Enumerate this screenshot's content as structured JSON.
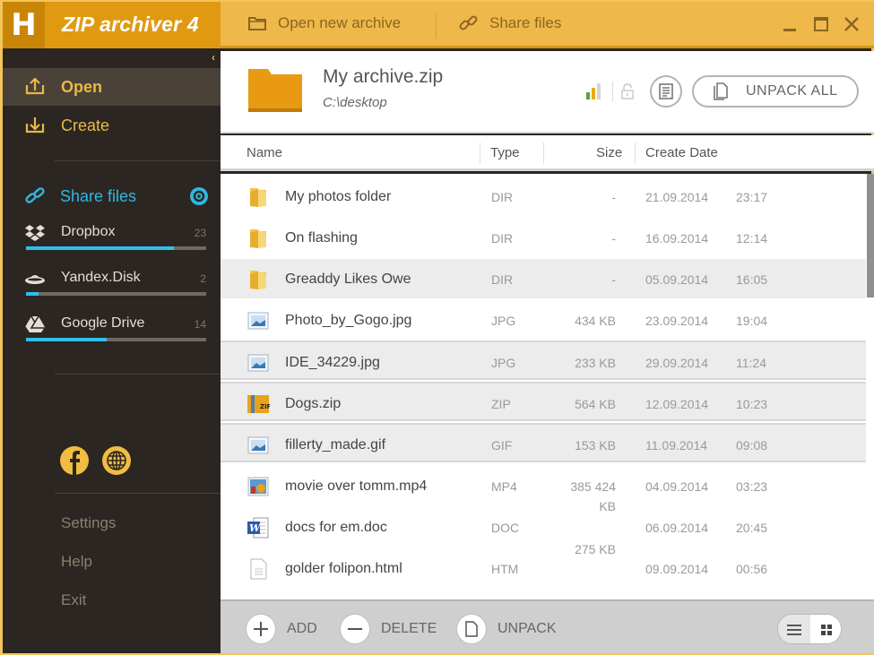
{
  "app": {
    "logo_letter": "H",
    "title": "ZIP archiver 4"
  },
  "colors": {
    "brand_orange": "#e09a12",
    "toolbar_yellow": "#efb84a",
    "sidebar_dark": "#2b2621",
    "accent_gold": "#e9b945",
    "share_blue": "#2fb7e2",
    "progress_blue": "#2ec0ec"
  },
  "toolbar": {
    "open_new_archive": "Open new archive",
    "share_files": "Share files",
    "icons": [
      "folder-icon",
      "link-icon",
      "minimize-icon",
      "maximize-icon",
      "close-icon"
    ]
  },
  "sidebar": {
    "collapse_glyph": "‹",
    "nav": [
      {
        "label": "Open",
        "icon": "open-upload-icon",
        "active": true
      },
      {
        "label": "Create",
        "icon": "create-download-icon",
        "active": false
      }
    ],
    "share": {
      "label": "Share files",
      "icon": "link-icon",
      "settings_icon": "gear-icon"
    },
    "clouds": [
      {
        "name": "Dropbox",
        "count": "23",
        "icon": "dropbox-icon",
        "progress": 0.82
      },
      {
        "name": "Yandex.Disk",
        "count": "2",
        "icon": "yandex-disk-icon",
        "progress": 0.07
      },
      {
        "name": "Google Drive",
        "count": "14",
        "icon": "google-drive-icon",
        "progress": 0.45
      }
    ],
    "social": [
      "facebook-icon",
      "globe-icon"
    ],
    "links": [
      "Settings",
      "Help",
      "Exit"
    ]
  },
  "archive": {
    "name": "My archive.zip",
    "path": "C:\\desktop",
    "unpack_all": "UNPACK ALL",
    "icons": [
      "signal-strength-icon",
      "lock-icon",
      "info-document-icon"
    ]
  },
  "table": {
    "columns": [
      "Name",
      "Type",
      "Size",
      "Create Date"
    ],
    "rows": [
      {
        "name": "My photos folder",
        "type": "DIR",
        "size": "-",
        "date": "21.09.2014",
        "time": "23:17",
        "icon": "folder-icon"
      },
      {
        "name": "On flashing",
        "type": "DIR",
        "size": "-",
        "date": "16.09.2014",
        "time": "12:14",
        "icon": "folder-icon"
      },
      {
        "name": "Greaddy Likes Owe",
        "type": "DIR",
        "size": "-",
        "date": "05.09.2014",
        "time": "16:05",
        "icon": "folder-icon"
      },
      {
        "name": "Photo_by_Gogo.jpg",
        "type": "JPG",
        "size": "434 KB",
        "date": "23.09.2014",
        "time": "19:04",
        "icon": "image-file-icon"
      },
      {
        "name": "IDE_34229.jpg",
        "type": "JPG",
        "size": "233 KB",
        "date": "29.09.2014",
        "time": "11:24",
        "icon": "image-file-icon"
      },
      {
        "name": "Dogs.zip",
        "type": "ZIP",
        "size": "564 KB",
        "date": "12.09.2014",
        "time": "10:23",
        "icon": "zip-file-icon"
      },
      {
        "name": "fillerty_made.gif",
        "type": "GIF",
        "size": "153 KB",
        "date": "11.09.2014",
        "time": "09:08",
        "icon": "image-file-icon"
      },
      {
        "name": "movie over tomm.mp4",
        "type": "MP4",
        "size": "385 424",
        "size_overflow": "KB",
        "date": "04.09.2014",
        "time": "03:23",
        "icon": "video-file-icon"
      },
      {
        "name": "docs for em.doc",
        "type": "DOC",
        "size": "",
        "date": "06.09.2014",
        "time": "20:45",
        "icon": "word-doc-icon"
      },
      {
        "name": "golder folipon.html",
        "type": "HTM",
        "size": "",
        "size_above": "275 KB",
        "date": "09.09.2014",
        "time": "00:56",
        "icon": "text-file-icon"
      }
    ]
  },
  "bottom": {
    "add": "ADD",
    "delete": "DELETE",
    "unpack": "UNPACK",
    "views": [
      "list-view-icon",
      "grid-view-icon"
    ]
  }
}
